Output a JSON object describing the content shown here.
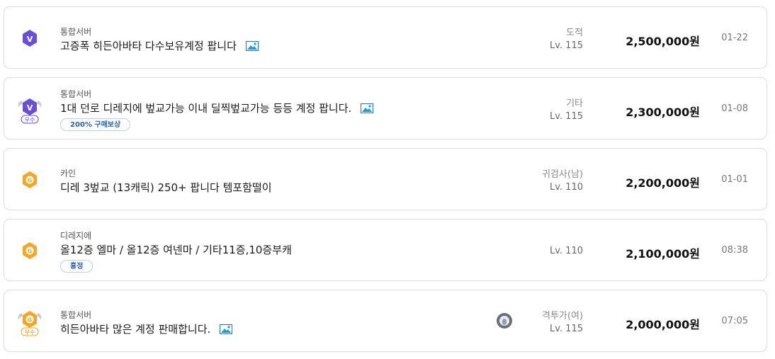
{
  "listings": [
    {
      "server": "통합서버",
      "title": "고증폭 히든아바타 다수보유계정 팝니다",
      "has_image": true,
      "tag": null,
      "class": "도적",
      "level": "Lv. 115",
      "price": "2,500,000원",
      "date": "01-22",
      "badge": {
        "shape": "v-hexagon",
        "color": "#6a4fd6",
        "letter": "V",
        "wings": false,
        "grade_label": null
      }
    },
    {
      "server": "통합서버",
      "title": "1대 던로 디레지에 벞교가능 이내 딜찍벞교가능 등등 계정 팝니다.",
      "has_image": true,
      "tag": "200% 구매보상",
      "class": "기타",
      "level": "Lv. 115",
      "price": "2,300,000원",
      "date": "01-08",
      "badge": {
        "shape": "v-hexagon",
        "color": "#6a4fd6",
        "letter": "V",
        "wings": true,
        "grade_label": "우수"
      }
    },
    {
      "server": "카인",
      "title": "디레 3벞교 (13캐릭) 250+ 팝니다 템포함떨이",
      "has_image": false,
      "tag": null,
      "class": "귀검사(남)",
      "level": "Lv. 110",
      "price": "2,200,000원",
      "date": "01-01",
      "badge": {
        "shape": "g-hexagon",
        "color": "#f5a623",
        "letter": "G",
        "wings": false,
        "grade_label": null
      }
    },
    {
      "server": "디레지에",
      "title": "올12증 엘마 / 올12증 여넨마 / 기타11증,10증부캐",
      "has_image": false,
      "tag": "흥정",
      "class": "",
      "level": "Lv. 110",
      "price": "2,100,000원",
      "date": "08:38",
      "badge": {
        "shape": "g-hexagon",
        "color": "#f5a623",
        "letter": "G",
        "wings": false,
        "grade_label": null
      }
    },
    {
      "server": "통합서버",
      "title": "히든아바타 많은 계정 판매합니다.",
      "has_image": true,
      "tag": null,
      "class": "격투가(여)",
      "level": "Lv. 115",
      "price": "2,000,000원",
      "date": "07:05",
      "has_seller_avatar": true,
      "badge": {
        "shape": "g-hexagon",
        "color": "#f5a623",
        "letter": "G",
        "wings": true,
        "grade_label": "우수"
      }
    }
  ],
  "icons": {
    "image_attachment": "image-icon",
    "seller_avatar": "avatar-icon"
  }
}
